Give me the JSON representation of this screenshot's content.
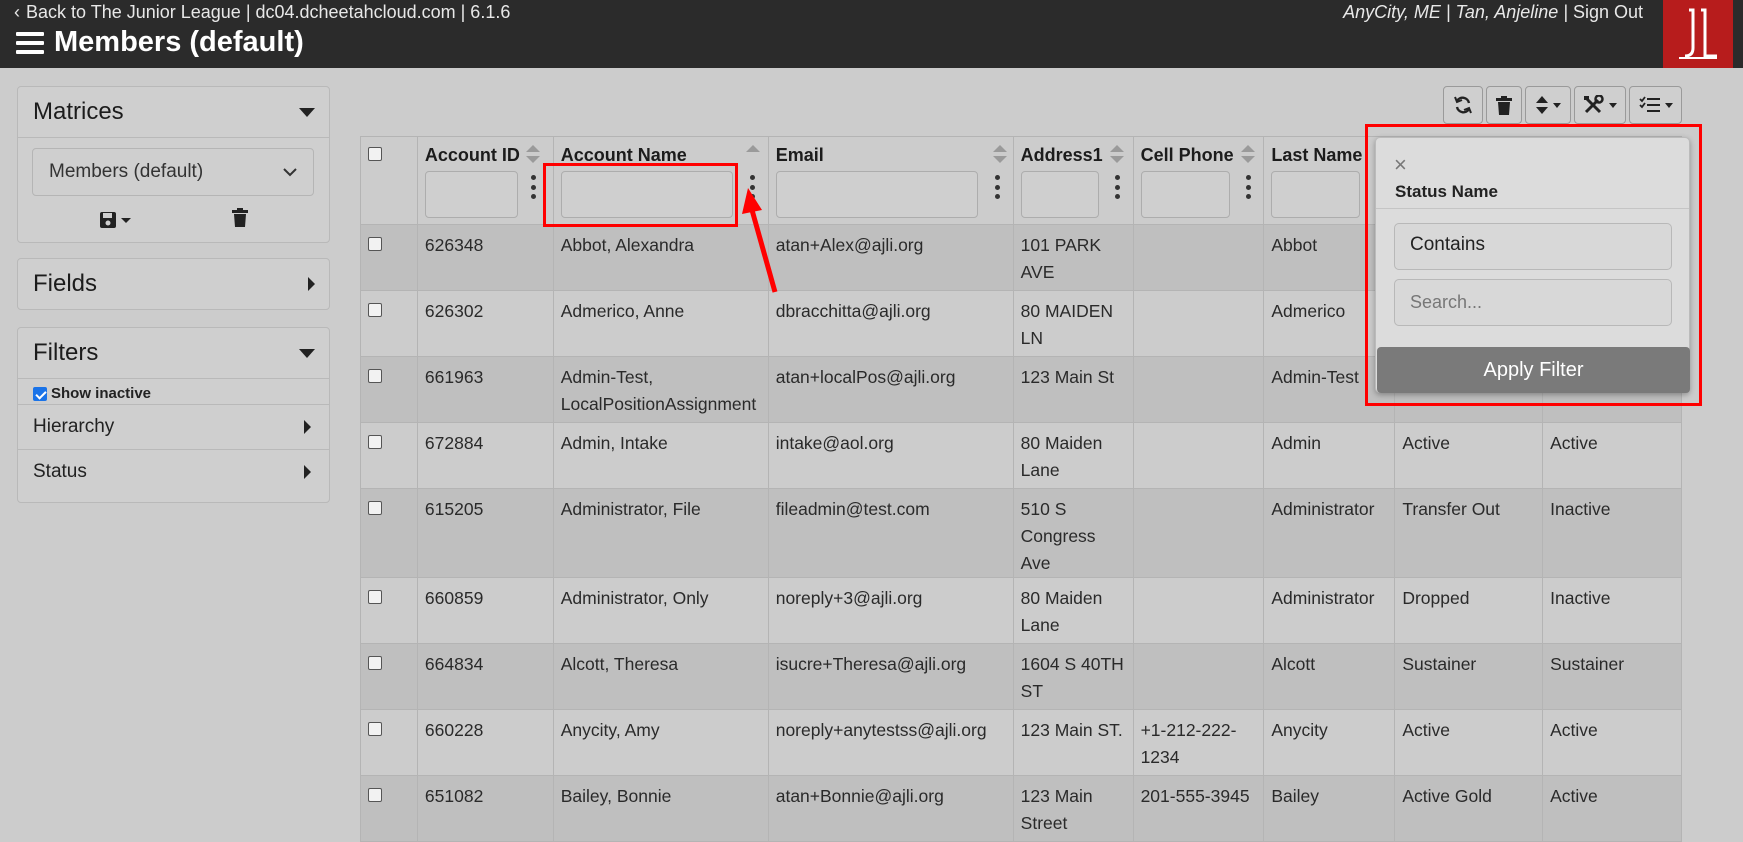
{
  "header": {
    "back_text": "Back to The Junior League | dc04.dcheetahcloud.com | 6.1.6",
    "title": "Members (default)",
    "user_location": "AnyCity, ME",
    "user_name": "Tan, Anjeline",
    "sign_out": "Sign Out"
  },
  "sidebar": {
    "matrices": {
      "heading": "Matrices",
      "selected": "Members (default)"
    },
    "fields": {
      "heading": "Fields"
    },
    "filters": {
      "heading": "Filters",
      "show_inactive": "Show inactive",
      "show_inactive_checked": true,
      "items": [
        "Hierarchy",
        "Status"
      ]
    }
  },
  "table": {
    "columns": [
      "Account ID",
      "Account Name",
      "Email",
      "Address1",
      "Cell Phone",
      "Last Name"
    ],
    "rows": [
      [
        "626348",
        "Abbot, Alexandra",
        "atan+Alex@ajli.org",
        "101 PARK AVE",
        "",
        "Abbot",
        "",
        ""
      ],
      [
        "626302",
        "Admerico, Anne",
        "dbracchitta@ajli.org",
        "80 MAIDEN LN",
        "",
        "Admerico",
        "",
        ""
      ],
      [
        "661963",
        "Admin-Test, LocalPositionAssignment",
        "atan+localPos@ajli.org",
        "123 Main St",
        "",
        "Admin-Test",
        "",
        ""
      ],
      [
        "672884",
        "Admin, Intake",
        "intake@aol.org",
        "80 Maiden Lane",
        "",
        "Admin",
        "Active",
        "Active"
      ],
      [
        "615205",
        "Administrator, File",
        "fileadmin@test.com",
        "510 S Congress Ave",
        "",
        "Administrator",
        "Transfer Out",
        "Inactive"
      ],
      [
        "660859",
        "Administrator, Only",
        "noreply+3@ajli.org",
        "80 Maiden Lane",
        "",
        "Administrator",
        "Dropped",
        "Inactive"
      ],
      [
        "664834",
        "Alcott, Theresa",
        "isucre+Theresa@ajli.org",
        "1604 S 40TH ST",
        "",
        "Alcott",
        "Sustainer",
        "Sustainer"
      ],
      [
        "660228",
        "Anycity, Amy",
        "noreply+anytestss@ajli.org",
        "123 Main ST.",
        "+1-212-222-1234",
        "Anycity",
        "Active",
        "Active"
      ],
      [
        "651082",
        "Bailey, Bonnie",
        "atan+Bonnie@ajli.org",
        "123 Main Street",
        "201-555-3945",
        "Bailey",
        "Active Gold",
        "Active"
      ]
    ]
  },
  "popover": {
    "close": "×",
    "title": "Status Name",
    "operator": "Contains",
    "search_placeholder": "Search...",
    "apply_label": "Apply Filter"
  },
  "colors": {
    "annotation": "#ff0000",
    "header_bg": "#2b2b2b",
    "logo_bg": "#b71c1c"
  }
}
